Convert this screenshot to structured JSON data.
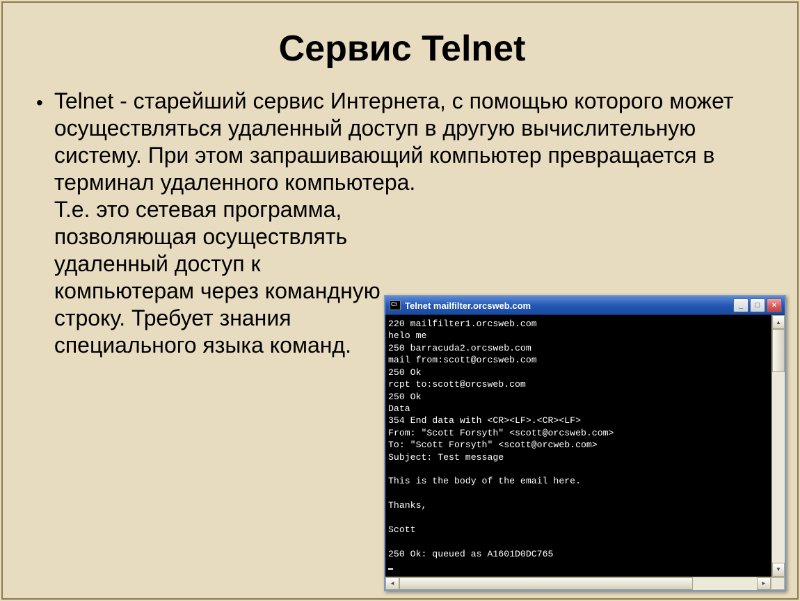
{
  "slide": {
    "title": "Сервис Telnet",
    "bullet": "•",
    "paragraph1": "Telnet   -   старейший сервис Интернета, с помощью которого может осуществляться удаленный доступ в другую вычислительную систему. При этом запрашивающий компьютер превращается в терминал удаленного компьютера.",
    "paragraph2": "Т.е. это сетевая программа, позволяющая осуществлять удаленный доступ к компьютерам через командную строку. Требует знания специального языка команд."
  },
  "terminal": {
    "window_title": "Telnet mailfilter.orcsweb.com",
    "buttons": {
      "min": "_",
      "max": "□",
      "close": "×"
    },
    "scroll": {
      "up": "▲",
      "down": "▼",
      "left": "◄",
      "right": "►"
    },
    "lines": [
      "220 mailfilter1.orcsweb.com",
      "helo me",
      "250 barracuda2.orcsweb.com",
      "mail from:scott@orcsweb.com",
      "250 Ok",
      "rcpt to:scott@orcsweb.com",
      "250 Ok",
      "Data",
      "354 End data with <CR><LF>.<CR><LF>",
      "From: \"Scott Forsyth\" <scott@orcsweb.com>",
      "To: \"Scott Forsyth\" <scott@orcweb.com>",
      "Subject: Test message",
      "",
      "This is the body of the email here.",
      "",
      "Thanks,",
      "",
      "Scott",
      "",
      "250 Ok: queued as A1601D0DC765"
    ]
  }
}
